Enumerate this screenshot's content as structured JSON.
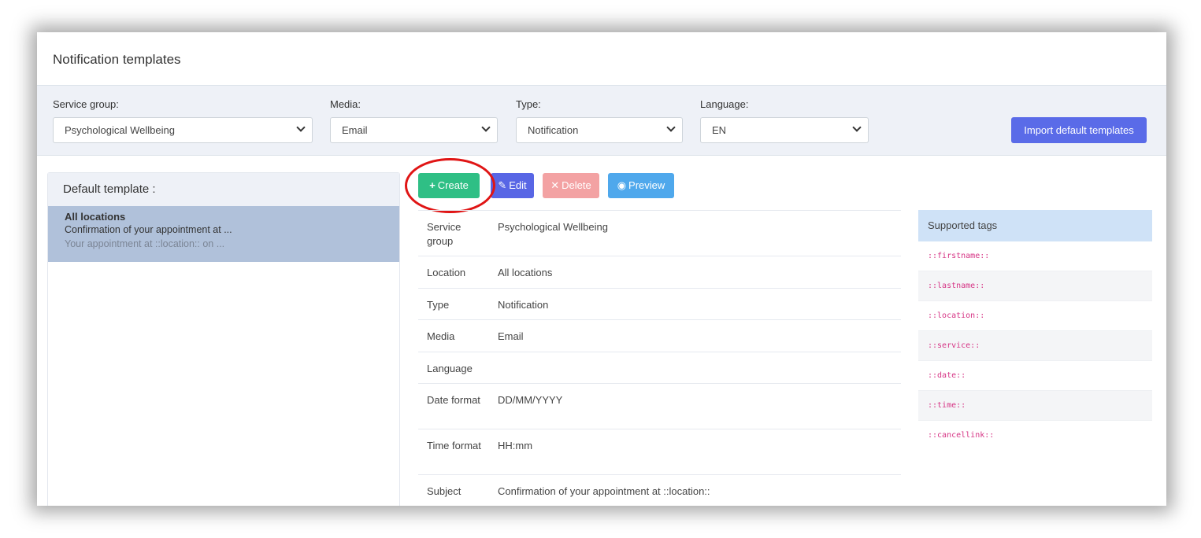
{
  "page": {
    "title": "Notification templates"
  },
  "filters": {
    "service_group": {
      "label": "Service group:",
      "value": "Psychological Wellbeing"
    },
    "media": {
      "label": "Media:",
      "value": "Email"
    },
    "type": {
      "label": "Type:",
      "value": "Notification"
    },
    "language": {
      "label": "Language:",
      "value": "EN"
    },
    "import_button": "Import default templates"
  },
  "left_panel": {
    "heading": "Default template :",
    "items": [
      {
        "title": "All locations",
        "subject": "Confirmation of your appointment at ...",
        "body": "Your appointment at ::location:: on ..."
      }
    ]
  },
  "toolbar": {
    "create": "Create",
    "edit": "Edit",
    "delete": "Delete",
    "preview": "Preview"
  },
  "details": {
    "rows": [
      {
        "label": "Service group",
        "value": "Psychological Wellbeing"
      },
      {
        "label": "Location",
        "value": "All locations"
      },
      {
        "label": "Type",
        "value": "Notification"
      },
      {
        "label": "Media",
        "value": "Email"
      },
      {
        "label": "Language",
        "value": ""
      },
      {
        "label": "Date format",
        "value": "DD/MM/YYYY"
      },
      {
        "label": "Time format",
        "value": "HH:mm"
      },
      {
        "label": "Subject",
        "value": "Confirmation of your appointment at ::location::"
      }
    ]
  },
  "tags": {
    "heading": "Supported tags",
    "items": [
      "::firstname::",
      "::lastname::",
      "::location::",
      "::service::",
      "::date::",
      "::time::",
      "::cancellink::"
    ]
  },
  "colors": {
    "create": "#2fbf85",
    "edit": "#5866e5",
    "delete": "#f3a2a3",
    "preview": "#4fa8ec",
    "import": "#5a6be8",
    "highlight": "#e01515",
    "selected_item": "#b0c1da",
    "tag_text": "#d63384"
  }
}
